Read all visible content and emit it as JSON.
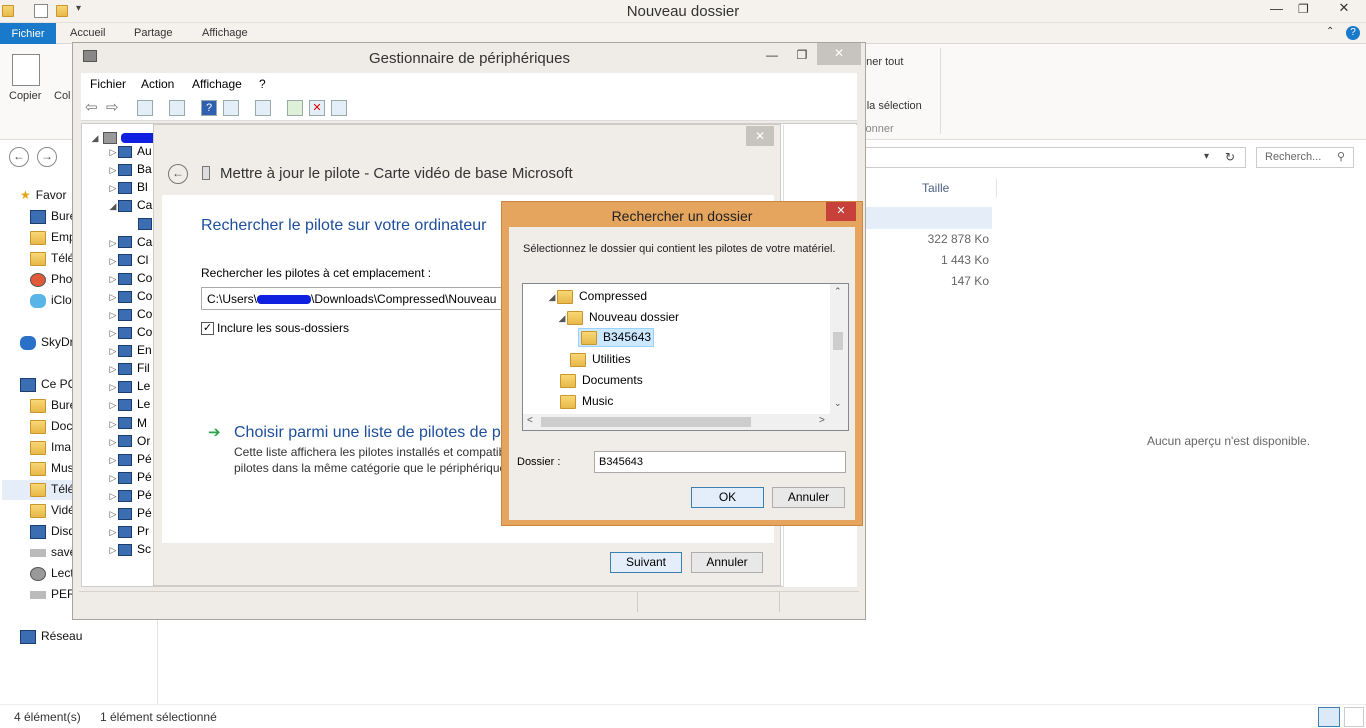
{
  "explorer": {
    "title": "Nouveau dossier",
    "tabs": {
      "file": "Fichier",
      "home": "Accueil",
      "share": "Partage",
      "view": "Affichage"
    },
    "ribbon": {
      "copy": "Copier",
      "paste_partial": "Col",
      "select_all_partial": "nner tout",
      "invert_partial": "r la sélection",
      "group_partial": "tionner"
    },
    "search_placeholder": "Recherch...",
    "columns": {
      "size": "Taille"
    },
    "sizes": [
      "322 878 Ko",
      "1 443 Ko",
      "147 Ko"
    ],
    "preview": "Aucun aperçu n'est disponible.",
    "nav": {
      "favorites": "Favor",
      "fav_items": [
        "Bure",
        "Emp",
        "Télé",
        "Pho",
        "iClo"
      ],
      "skydrive": "SkyDr",
      "thispc": "Ce PC",
      "pc_items": [
        "Bure",
        "Doc",
        "Ima",
        "Mus",
        "Télé",
        "Vidé",
        "Disq",
        "save",
        "Lect",
        "PER"
      ],
      "network": "Réseau"
    },
    "status": {
      "count": "4 élément(s)",
      "selected": "1 élément sélectionné"
    }
  },
  "devmgr": {
    "title": "Gestionnaire de périphériques",
    "menu": [
      "Fichier",
      "Action",
      "Affichage",
      "?"
    ],
    "tree": [
      "Au",
      "Ba",
      "Bl",
      "Ca",
      "",
      "Ca",
      "Cl",
      "Co",
      "Co",
      "Co",
      "Co",
      "En",
      "Fil",
      "Le",
      "Le",
      "M",
      "Or",
      "Pé",
      "Pé",
      "Pé",
      "Pé",
      "Pr",
      "Sc"
    ]
  },
  "wizard": {
    "title": "Mettre à jour le pilote - Carte vidéo de base Microsoft",
    "heading": "Rechercher le pilote sur votre ordinateur",
    "search_label": "Rechercher les pilotes à cet emplacement :",
    "path_prefix": "C:\\Users\\",
    "path_suffix": "\\Downloads\\Compressed\\Nouveau",
    "include_sub": "Inclure les sous-dossiers",
    "choose_title": "Choisir parmi une liste de pilotes de pé",
    "choose_desc1": "Cette liste affichera les pilotes installés et compatib",
    "choose_desc2": "pilotes dans la même catégorie que le périphérique",
    "next": "Suivant",
    "cancel": "Annuler"
  },
  "browse": {
    "title": "Rechercher un dossier",
    "instruction": "Sélectionnez le dossier qui contient les pilotes de votre matériel.",
    "tree": {
      "compressed": "Compressed",
      "nouveau": "Nouveau dossier",
      "selected": "B345643",
      "utilities": "Utilities",
      "documents": "Documents",
      "music": "Music"
    },
    "folder_label": "Dossier :",
    "folder_value": "B345643",
    "ok": "OK",
    "cancel": "Annuler",
    "close": "✕"
  }
}
